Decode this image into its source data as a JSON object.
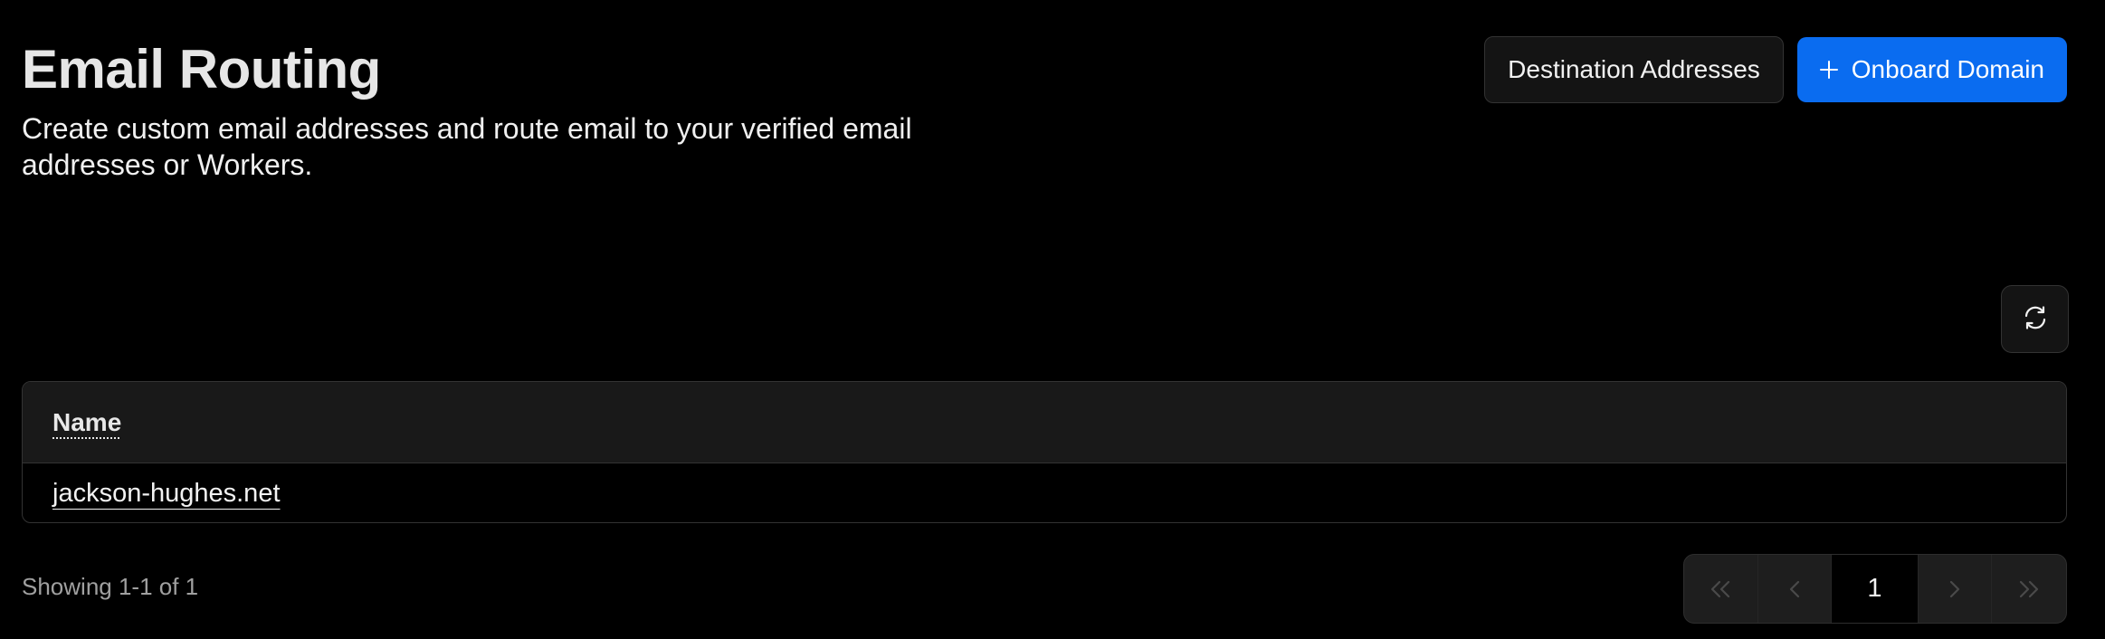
{
  "header": {
    "title": "Email Routing",
    "description": "Create custom email addresses and route email to your verified email addresses or Workers."
  },
  "actions": {
    "destination_addresses_label": "Destination Addresses",
    "onboard_domain_label": "Onboard Domain",
    "onboard_domain_icon": "plus-icon"
  },
  "toolbar": {
    "refresh_icon": "refresh-icon"
  },
  "table": {
    "columns": [
      {
        "label": "Name"
      }
    ],
    "rows": [
      {
        "name": "jackson-hughes.net"
      }
    ]
  },
  "footer": {
    "showing_text": "Showing 1-1 of 1"
  },
  "pagination": {
    "current_page": "1",
    "icons": [
      "first-page-icon",
      "previous-page-icon",
      "next-page-icon",
      "last-page-icon"
    ]
  },
  "colors": {
    "background": "#000000",
    "primary": "#0a6cf0",
    "panel": "#191919",
    "border": "#333333",
    "muted_text": "#a0a0a0"
  }
}
